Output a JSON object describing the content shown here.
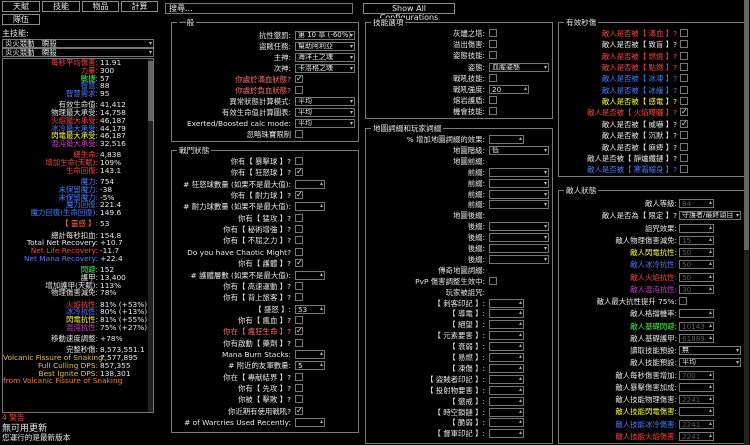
{
  "tabs": [
    "天賦",
    "技能",
    "物品",
    "計算",
    "隊伍"
  ],
  "main_skill": {
    "label": "主技能:",
    "skill": "炎火競動　瞬殺",
    "part": "炎火競動　瞬殺"
  },
  "stats": [
    {
      "k": "每秒平均傷害:",
      "v": "11.91",
      "c": "#ff4040"
    },
    {
      "k": "力量:",
      "v": "300",
      "c": "#ff4040"
    },
    {
      "k": "敏捷:",
      "v": "57",
      "c": "#40ff40"
    },
    {
      "k": "智慧:",
      "v": "88",
      "c": "#4a7cff"
    },
    {
      "k": "智慧需求:",
      "v": "95",
      "c": "#4a7cff"
    },
    {
      "sp": true
    },
    {
      "k": "有效生命值:",
      "v": "41,412",
      "c": "#e8e8e8"
    },
    {
      "k": "物理最大承受:",
      "v": "14,758",
      "c": "#e8e8e8"
    },
    {
      "k": "火焰最大承受:",
      "v": "46,187",
      "c": "#ff4040"
    },
    {
      "k": "冰冷最大承受:",
      "v": "44,179",
      "c": "#4a7cff"
    },
    {
      "k": "閃電最大承受:",
      "v": "46,187",
      "c": "#ffff40"
    },
    {
      "k": "混沌最大承受:",
      "v": "32,516",
      "c": "#d040d0"
    },
    {
      "sp": true
    },
    {
      "k": "總生命:",
      "v": "4,838",
      "c": "#ff4040"
    },
    {
      "k": "增加生命(天賦):",
      "v": "109%",
      "c": "#ff4040"
    },
    {
      "k": "生命回復:",
      "v": "143.1",
      "c": "#ff4040"
    },
    {
      "sp": true
    },
    {
      "k": "魔力:",
      "v": "754",
      "c": "#4a7cff"
    },
    {
      "k": "未保留魔力:",
      "v": "-38",
      "c": "#4a7cff"
    },
    {
      "k": "未保留魔力:",
      "v": "-5%",
      "c": "#4a7cff"
    },
    {
      "k": "魔力回復:",
      "v": "221.4",
      "c": "#4a7cff"
    },
    {
      "k": "魔力回復(生命回復):",
      "v": "149.6",
      "c": "#4a7cff"
    },
    {
      "sp": true
    },
    {
      "k": "【 靈感 】:",
      "v": "53",
      "c": "#ff7830"
    },
    {
      "sp": true
    },
    {
      "k": "總計每秒扣血:",
      "v": "154.8",
      "c": "#e8e8e8"
    },
    {
      "k": "Total Net Recovery:",
      "v": "+10.7",
      "c": "#e8e8e8"
    },
    {
      "k": "Net Life Recovery:",
      "v": "-11.7",
      "c": "#ff4040"
    },
    {
      "k": "Net Mana Recovery:",
      "v": "+22.4",
      "c": "#4a7cff"
    },
    {
      "sp": true
    },
    {
      "k": "閃避:",
      "v": "152",
      "c": "#40ff40"
    },
    {
      "k": "護甲:",
      "v": "13,400",
      "c": "#e8e8e8"
    },
    {
      "k": "增加護甲(天賦):",
      "v": "113%",
      "c": "#e8e8e8"
    },
    {
      "k": "物理傷害減免:",
      "v": "78%",
      "c": "#e8e8e8"
    },
    {
      "sp": true
    },
    {
      "k": "火焰抗性:",
      "v": "81% (+53%)",
      "c": "#ff4040"
    },
    {
      "k": "冰冷抗性:",
      "v": "80% (+13%)",
      "c": "#4a7cff"
    },
    {
      "k": "閃電抗性:",
      "v": "81% (+55%)",
      "c": "#ffff40"
    },
    {
      "k": "混沌抗性:",
      "v": "75% (+27%)",
      "c": "#d040d0"
    },
    {
      "sp": true
    },
    {
      "k": "移動速度調整:",
      "v": "+78%",
      "c": "#e8e8e8"
    },
    {
      "sp": true
    },
    {
      "k": "完整秒傷:",
      "v": "8,573,551.1",
      "c": "#e8e8e8"
    },
    {
      "k": "Volcanic Fissure of Snaking:",
      "v": "7,577,895",
      "c": "#e0c060"
    },
    {
      "k": "Full Culling DPS:",
      "v": "857,355",
      "c": "#e0c060"
    },
    {
      "k": "Best Ignite DPS:",
      "v": "138,301",
      "c": "#e0c060"
    },
    {
      "k": "from Volcanic Fissure of Snaking",
      "v": "",
      "c": "#ff7830"
    }
  ],
  "warning": "4 警告",
  "update": "無可用更新",
  "update_sub": "您運行的是最新版本",
  "search": {
    "value": "搜尋..."
  },
  "show_all": "Show All Configurations",
  "general": {
    "title": "一般",
    "rows": [
      {
        "k": "抗性懲罰:",
        "t": "dd",
        "v": "第 10 章 (-60%)"
      },
      {
        "k": "盜賊任務:",
        "t": "dd",
        "v": "幫助阿利亞"
      },
      {
        "k": "主神:",
        "t": "dd",
        "v": "海洋王之魂"
      },
      {
        "k": "次神:",
        "t": "dd",
        "v": "卡洛格之魂"
      },
      {
        "k": "你處於滿血狀態?",
        "t": "cb",
        "on": true,
        "kc": "#ff7070"
      },
      {
        "k": "你處於負血狀態?",
        "t": "cb",
        "on": false,
        "kc": "#ff7070"
      },
      {
        "k": "異常狀態計算模式:",
        "t": "dd",
        "v": "平均"
      },
      {
        "k": "有效生命值計算圖表:",
        "t": "dd",
        "v": "平均"
      },
      {
        "k": "Exerted/Boosted calc mode:",
        "t": "dd",
        "v": "平均"
      },
      {
        "k": "忽略珠寶限制",
        "t": "cb",
        "on": false
      }
    ]
  },
  "combat": {
    "title": "戰鬥狀態",
    "rows": [
      {
        "k": "你有【 暴擊球 】?",
        "t": "cb",
        "on": false
      },
      {
        "k": "你有【 狂怒球 】?",
        "t": "cb",
        "on": true
      },
      {
        "k": "# 狂怒球數量 (如果不是最大值):",
        "t": "in",
        "v": ""
      },
      {
        "k": "你有【 耐力球 】?",
        "t": "cb",
        "on": true
      },
      {
        "k": "# 耐力球數量 (如果不是最大值):",
        "t": "in",
        "v": ""
      },
      {
        "k": "你有【 猛攻 】?",
        "t": "cb",
        "on": false
      },
      {
        "k": "你有【 秘術增強 】?",
        "t": "cb",
        "on": false
      },
      {
        "k": "你有【 不屈之力 】?",
        "t": "cb",
        "on": false
      },
      {
        "k": "Do you have Chaotic Might?",
        "t": "cb",
        "on": false
      },
      {
        "k": "你有【 護體 】?",
        "t": "cb",
        "on": true
      },
      {
        "k": "# 護體層數 (如果不是最大值):",
        "t": "in",
        "v": ""
      },
      {
        "k": "你有【 高速運動 】?",
        "t": "cb",
        "on": false
      },
      {
        "k": "你有【 背上旅客 】?",
        "t": "cb",
        "on": false
      },
      {
        "k": "【 盛怒 】:",
        "t": "in",
        "v": "53"
      },
      {
        "k": "你有【 瘋血 】?",
        "t": "cb",
        "on": false
      },
      {
        "k": "你在【 瘋狂生命 】?",
        "t": "cb",
        "on": true,
        "kc": "#ff7070"
      },
      {
        "k": "你有啟動【 藥劑 】?",
        "t": "cb",
        "on": false
      },
      {
        "k": "Mana Burn Stacks:",
        "t": "in",
        "v": ""
      },
      {
        "k": "# 附近的友軍數量:",
        "t": "in",
        "v": "5"
      },
      {
        "k": "你在【 專献結界 】?",
        "t": "cb",
        "on": false
      },
      {
        "k": "你有【 先攻 】?",
        "t": "cb",
        "on": false
      },
      {
        "k": "你被【 擊敗 】?",
        "t": "cb",
        "on": false
      },
      {
        "k": "你近期有使用戰吼?",
        "t": "cb",
        "on": true
      },
      {
        "k": "# of Warcries Used Recently:",
        "t": "in",
        "v": ""
      }
    ]
  },
  "skill_opts": {
    "title": "技能選項",
    "rows": [
      {
        "k": "灰燼之塔:",
        "t": "cb",
        "on": false
      },
      {
        "k": "溢出傷害:",
        "t": "cb",
        "on": false
      },
      {
        "k": "姿態技能:",
        "t": "cb",
        "on": false
      },
      {
        "k": "姿態:",
        "t": "dd",
        "v": "血腥姿態"
      },
      {
        "k": "戰吼技能:",
        "t": "cb",
        "on": false
      },
      {
        "k": "戰吼強度:",
        "t": "in",
        "v": "20"
      },
      {
        "k": "熔岩護盾:",
        "t": "cb",
        "on": false
      },
      {
        "k": "機會技能:",
        "t": "cb",
        "on": false
      }
    ]
  },
  "map_mods": {
    "title": "地圖詞綴和玩家詞綴",
    "rows": [
      {
        "k": "% 增加地圖詞綴的效果:",
        "t": "in",
        "v": ""
      },
      {
        "k": "地圖階級:",
        "t": "dd",
        "v": "低"
      },
      {
        "k": "地圖前綴:",
        "t": "none"
      },
      {
        "k": "前綴:",
        "t": "dd",
        "v": ""
      },
      {
        "k": "前綴:",
        "t": "dd",
        "v": ""
      },
      {
        "k": "前綴:",
        "t": "dd",
        "v": ""
      },
      {
        "k": "前綴:",
        "t": "dd",
        "v": ""
      },
      {
        "k": "地圖後綴:",
        "t": "none"
      },
      {
        "k": "後綴:",
        "t": "dd",
        "v": ""
      },
      {
        "k": "後綴:",
        "t": "dd",
        "v": ""
      },
      {
        "k": "後綴:",
        "t": "dd",
        "v": ""
      },
      {
        "k": "後綴:",
        "t": "dd",
        "v": ""
      },
      {
        "k": "傳奇地圖詞綴:",
        "t": "none"
      },
      {
        "k": "PvP 傷害調整生效中:",
        "t": "cb",
        "on": false
      },
      {
        "k": "玩家被詛咒:",
        "t": "none"
      },
      {
        "k": "【 刺客印記 】:",
        "t": "in",
        "v": ""
      },
      {
        "k": "【 導電 】:",
        "t": "in",
        "v": ""
      },
      {
        "k": "【 絕望 】:",
        "t": "in",
        "v": ""
      },
      {
        "k": "【 元素要害 】:",
        "t": "in",
        "v": ""
      },
      {
        "k": "【 衰弱 】:",
        "t": "in",
        "v": ""
      },
      {
        "k": "【 易燃 】:",
        "t": "in",
        "v": ""
      },
      {
        "k": "【 凍傷 】:",
        "t": "in",
        "v": ""
      },
      {
        "k": "【 盜賊者印記 】:",
        "t": "in",
        "v": ""
      },
      {
        "k": "【 投射物要害 】:",
        "t": "in",
        "v": ""
      },
      {
        "k": "【 懲戒 】:",
        "t": "in",
        "v": ""
      },
      {
        "k": "【 時空鎖鏈 】:",
        "t": "in",
        "v": ""
      },
      {
        "k": "【 脆弱 】:",
        "t": "in",
        "v": ""
      },
      {
        "k": "【 督軍印記 】:",
        "t": "in",
        "v": ""
      }
    ]
  },
  "eff_dps": {
    "title": "有效秒傷",
    "rows": [
      {
        "k": "敵人是否被【 滿血 】?",
        "c": "#ff4040",
        "on": false
      },
      {
        "k": "敵人是否被【 致盲 】?",
        "c": "#e8e8e8",
        "on": false
      },
      {
        "k": "敵人是否被【 燃燒 】?",
        "c": "#ff4040",
        "on": false
      },
      {
        "k": "敵人是否被【 點燃 】?",
        "c": "#ff4040",
        "on": false
      },
      {
        "k": "敵人是否被【 冰凍 】?",
        "c": "#4a7cff",
        "on": false
      },
      {
        "k": "敵人是否被【 冰緩 】?",
        "c": "#4a7cff",
        "on": false
      },
      {
        "k": "敵人是否被【 感電 】?",
        "c": "#ffff40",
        "on": false
      },
      {
        "k": "敵人是否被【 火焰曝曬 】?",
        "c": "#ff4040",
        "on": true
      },
      {
        "k": "敵人是否被【 威嚇 】?",
        "c": "#e8e8e8",
        "on": true
      },
      {
        "k": "敵人是否被【 沉默 】?",
        "c": "#e8e8e8",
        "on": false
      },
      {
        "k": "敵人是否被【 麻痺 】?",
        "c": "#e8e8e8",
        "on": false
      },
      {
        "k": "敵人是否被【 靜爐纖鏈 】?",
        "c": "#e8e8e8",
        "on": false
      },
      {
        "k": "敵人是否被【 寒霜縮身 】?",
        "c": "#4a7cff",
        "on": false
      }
    ]
  },
  "enemy": {
    "title": "敵人狀態",
    "rows": [
      {
        "k": "敵人等級:",
        "t": "in",
        "v": "84",
        "dim": true,
        "c": "#e8e8e8"
      },
      {
        "k": "敵人是否為【 限定 】?",
        "t": "dd",
        "v": "守護者/最終頭目",
        "c": "#e8e8e8"
      },
      {
        "k": "詛咒效果:",
        "t": "in",
        "v": "",
        "c": "#e8e8e8"
      },
      {
        "k": "敵人物理傷害減免:",
        "t": "in",
        "v": "15",
        "dim": true,
        "c": "#e8e8e8"
      },
      {
        "k": "敵人閃電抗性:",
        "t": "in",
        "v": "50",
        "dim": true,
        "c": "#ffff40"
      },
      {
        "k": "敵人冰冷抗性:",
        "t": "in",
        "v": "50",
        "dim": true,
        "c": "#4a7cff"
      },
      {
        "k": "敵人火焰抗性:",
        "t": "in",
        "v": "50",
        "dim": true,
        "c": "#ff4040"
      },
      {
        "k": "敵人混沌抗性:",
        "t": "in",
        "v": "30",
        "dim": true,
        "c": "#d040d0"
      },
      {
        "k": "敵人最大抗性提升 75%:",
        "t": "cb",
        "on": false,
        "c": "#e8e8e8"
      },
      {
        "k": "敵人格擋機率:",
        "t": "in",
        "v": "",
        "c": "#e8e8e8"
      },
      {
        "k": "敵人基礎閃避:",
        "t": "in",
        "v": "10143",
        "dim": true,
        "c": "#40ff40"
      },
      {
        "k": "敵人基礎護甲:",
        "t": "in",
        "v": "61889",
        "dim": true,
        "c": "#e8e8e8"
      },
      {
        "k": "讀取技能預設:",
        "t": "dd",
        "v": "無",
        "c": "#e8e8e8"
      },
      {
        "k": "敵人技能預設:",
        "t": "dd",
        "v": "平均",
        "c": "#e8e8e8"
      },
      {
        "k": "敵人每秒傷害增加:",
        "t": "in",
        "v": "700",
        "dim": true,
        "c": "#e8e8e8"
      },
      {
        "k": "敵人暴擊傷害加成:",
        "t": "in",
        "v": "",
        "c": "#e8e8e8"
      },
      {
        "k": "敵人技能物理傷害:",
        "t": "in",
        "v": "2241",
        "dim": true,
        "c": "#e8e8e8"
      },
      {
        "k": "敵人技能閃電傷害:",
        "t": "in",
        "v": "",
        "c": "#ffff40"
      },
      {
        "k": "敵人技能冰冷傷害:",
        "t": "in",
        "v": "2241",
        "dim": true,
        "c": "#4a7cff"
      },
      {
        "k": "敵人技能火焰傷害:",
        "t": "in",
        "v": "2241",
        "dim": true,
        "c": "#ff4040"
      }
    ]
  }
}
